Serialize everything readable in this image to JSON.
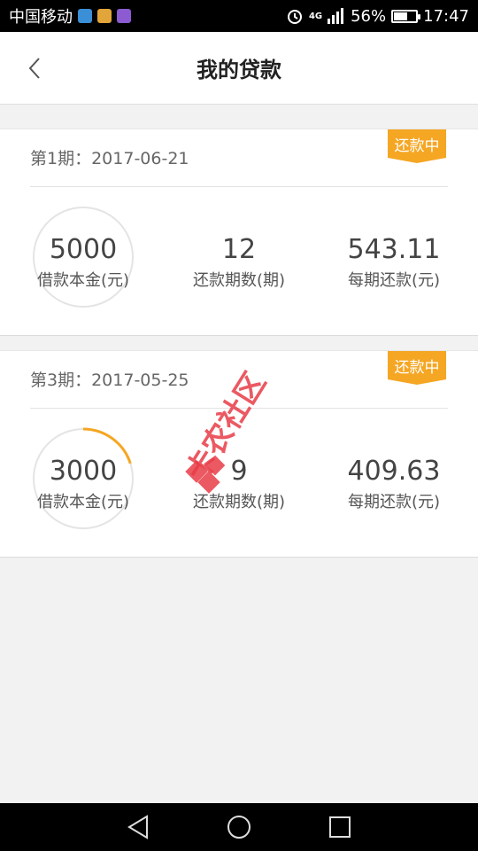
{
  "status_bar": {
    "carrier": "中国移动",
    "network": "4G",
    "battery_percent": "56%",
    "battery_level": 0.56,
    "time": "17:47"
  },
  "header": {
    "title": "我的贷款"
  },
  "loans": [
    {
      "period_label": "第1期：",
      "date": "2017-06-21",
      "status": "还款中",
      "progress": 0,
      "principal": "5000",
      "principal_label": "借款本金(元)",
      "periods": "12",
      "periods_label": "还款期数(期)",
      "payment": "543.11",
      "payment_label": "每期还款(元)"
    },
    {
      "period_label": "第3期：",
      "date": "2017-05-25",
      "status": "还款中",
      "progress": 0.2,
      "principal": "3000",
      "principal_label": "借款本金(元)",
      "periods": "9",
      "periods_label": "还款期数(期)",
      "payment": "409.63",
      "payment_label": "每期还款(元)"
    }
  ],
  "watermark": {
    "text": "卡农社区"
  },
  "colors": {
    "accent": "#f5a623",
    "ring_track": "#e4e4e4"
  }
}
